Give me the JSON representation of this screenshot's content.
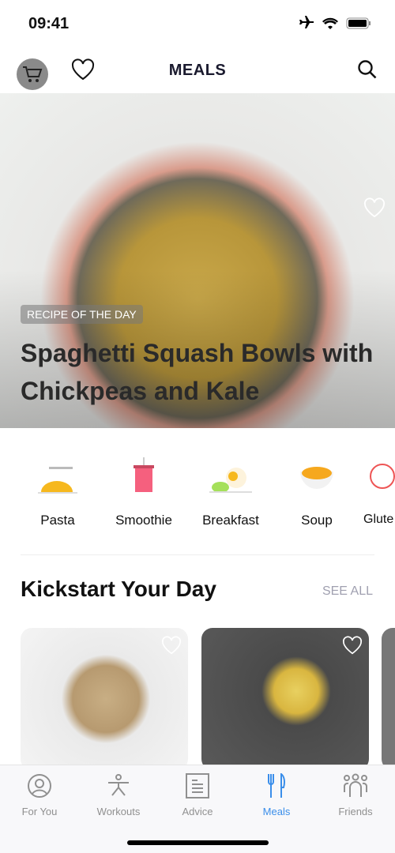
{
  "status": {
    "time": "09:41"
  },
  "nav": {
    "title": "MEALS"
  },
  "hero": {
    "label": "RECIPE OF THE DAY",
    "title": "Spaghetti Squash Bowls with Chickpeas and Kale"
  },
  "categories": [
    {
      "label": "Pasta",
      "icon": "pasta-icon"
    },
    {
      "label": "Smoothie",
      "icon": "smoothie-icon"
    },
    {
      "label": "Breakfast",
      "icon": "breakfast-icon"
    },
    {
      "label": "Soup",
      "icon": "soup-icon"
    },
    {
      "label": "Glute",
      "icon": "gluten-free-icon"
    }
  ],
  "section": {
    "title": "Kickstart Your Day",
    "see_all": "SEE ALL"
  },
  "tabs": [
    {
      "label": "For You",
      "icon": "person-icon"
    },
    {
      "label": "Workouts",
      "icon": "workout-icon"
    },
    {
      "label": "Advice",
      "icon": "document-icon"
    },
    {
      "label": "Meals",
      "icon": "fork-knife-icon",
      "active": true
    },
    {
      "label": "Friends",
      "icon": "friends-icon"
    }
  ],
  "colors": {
    "accent": "#3a8eea"
  }
}
